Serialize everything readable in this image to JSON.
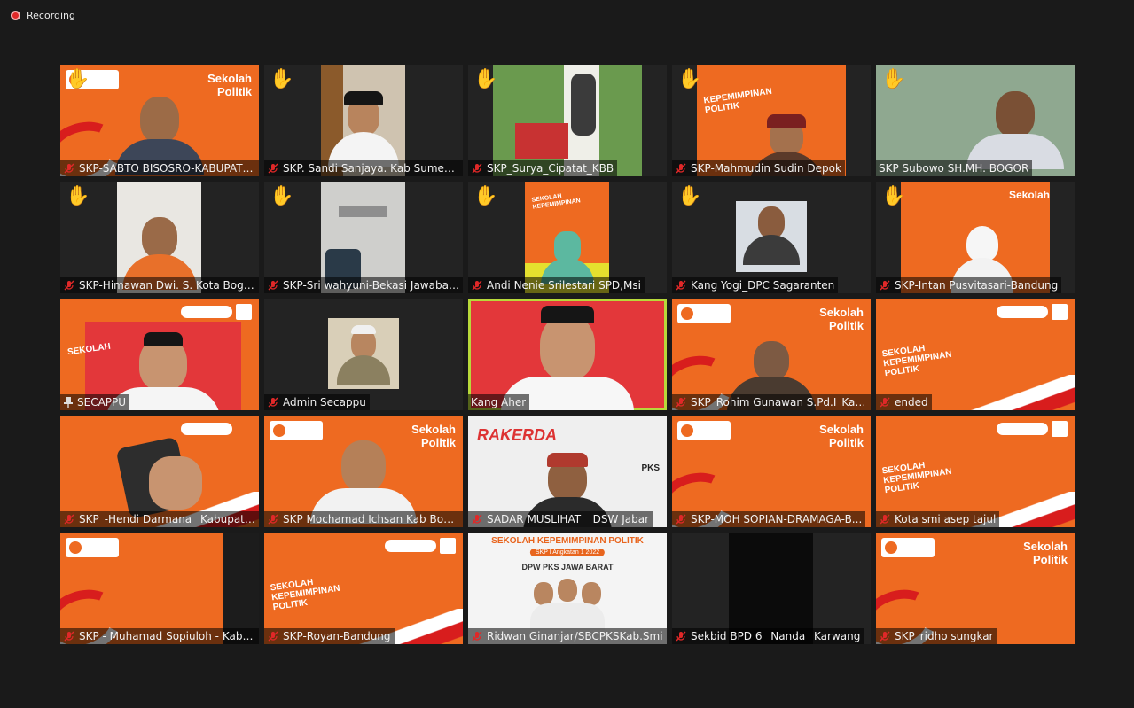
{
  "recording": {
    "label": "Recording"
  },
  "colors": {
    "accent_speaking": "#b8d93a",
    "muted_mic": "#e02828",
    "brand_orange": "#ee6a21"
  },
  "participants": [
    {
      "name": "SKP-SABTO BISOSRO-KABUPATE...",
      "muted": true,
      "hand_raised": true
    },
    {
      "name": "SKP. Sandi Sanjaya. Kab Sumeda...",
      "muted": true,
      "hand_raised": true
    },
    {
      "name": "SKP_Surya_Cipatat_KBB",
      "muted": true,
      "hand_raised": true
    },
    {
      "name": "SKP-Mahmudin Sudin Depok",
      "muted": true,
      "hand_raised": true
    },
    {
      "name": "SKP Subowo SH.MH. BOGOR",
      "muted": false,
      "hand_raised": true
    },
    {
      "name": "SKP-Himawan Dwi. S. Kota Bogo...",
      "muted": true,
      "hand_raised": true
    },
    {
      "name": "SKP-Sri wahyuni-Bekasi Jawabarat",
      "muted": true,
      "hand_raised": true
    },
    {
      "name": "Andi Nenie Srilestari SPD,Msi",
      "muted": true,
      "hand_raised": true
    },
    {
      "name": "Kang Yogi_DPC Sagaranten",
      "muted": true,
      "hand_raised": true
    },
    {
      "name": "SKP-Intan Pusvitasari-Bandung",
      "muted": true,
      "hand_raised": true
    },
    {
      "name": "SECAPPU",
      "muted": false,
      "pinned": true
    },
    {
      "name": "Admin Secappu",
      "muted": true
    },
    {
      "name": "Kang Aher",
      "muted": false,
      "speaking": true
    },
    {
      "name": "SKP_Rohim Gunawan S.Pd.I_Kab...",
      "muted": true
    },
    {
      "name": "ended",
      "muted": true
    },
    {
      "name": "SKP_-Hendi Darmana _Kabupate...",
      "muted": true
    },
    {
      "name": "SKP Mochamad Ichsan Kab Bogor",
      "muted": true
    },
    {
      "name": "SADAR MUSLIHAT _ DSW Jabar",
      "muted": true
    },
    {
      "name": "SKP-MOH SOPIAN-DRAMAGA-B...",
      "muted": true
    },
    {
      "name": "Kota smi asep tajul",
      "muted": true
    },
    {
      "name": "SKP - Muhamad Sopiuloh - Kab....",
      "muted": true
    },
    {
      "name": "SKP-Royan-Bandung",
      "muted": true
    },
    {
      "name": "Ridwan Ginanjar/SBCPKSKab.Smi",
      "muted": true
    },
    {
      "name": "Sekbid BPD 6_ Nanda _Karwang",
      "muted": true
    },
    {
      "name": "SKP_ridho sungkar",
      "muted": true
    }
  ],
  "backgrounds": {
    "sekolah_title_1": "Sekolah",
    "sekolah_title_2": "Kepemimpinan",
    "sekolah_title_3": "Politik",
    "skp_left_1": "SEKOLAH",
    "skp_left_2": "KEPEMIMPINAN",
    "skp_left_3": "POLITIK",
    "raker": "RAKERDA",
    "poster_title": "SEKOLAH KEPEMIMPINAN POLITIK",
    "poster_sub": "SKP I Angkatan 1 2022",
    "poster_org": "DPW PKS JAWA BARAT",
    "pks": "PKS"
  }
}
